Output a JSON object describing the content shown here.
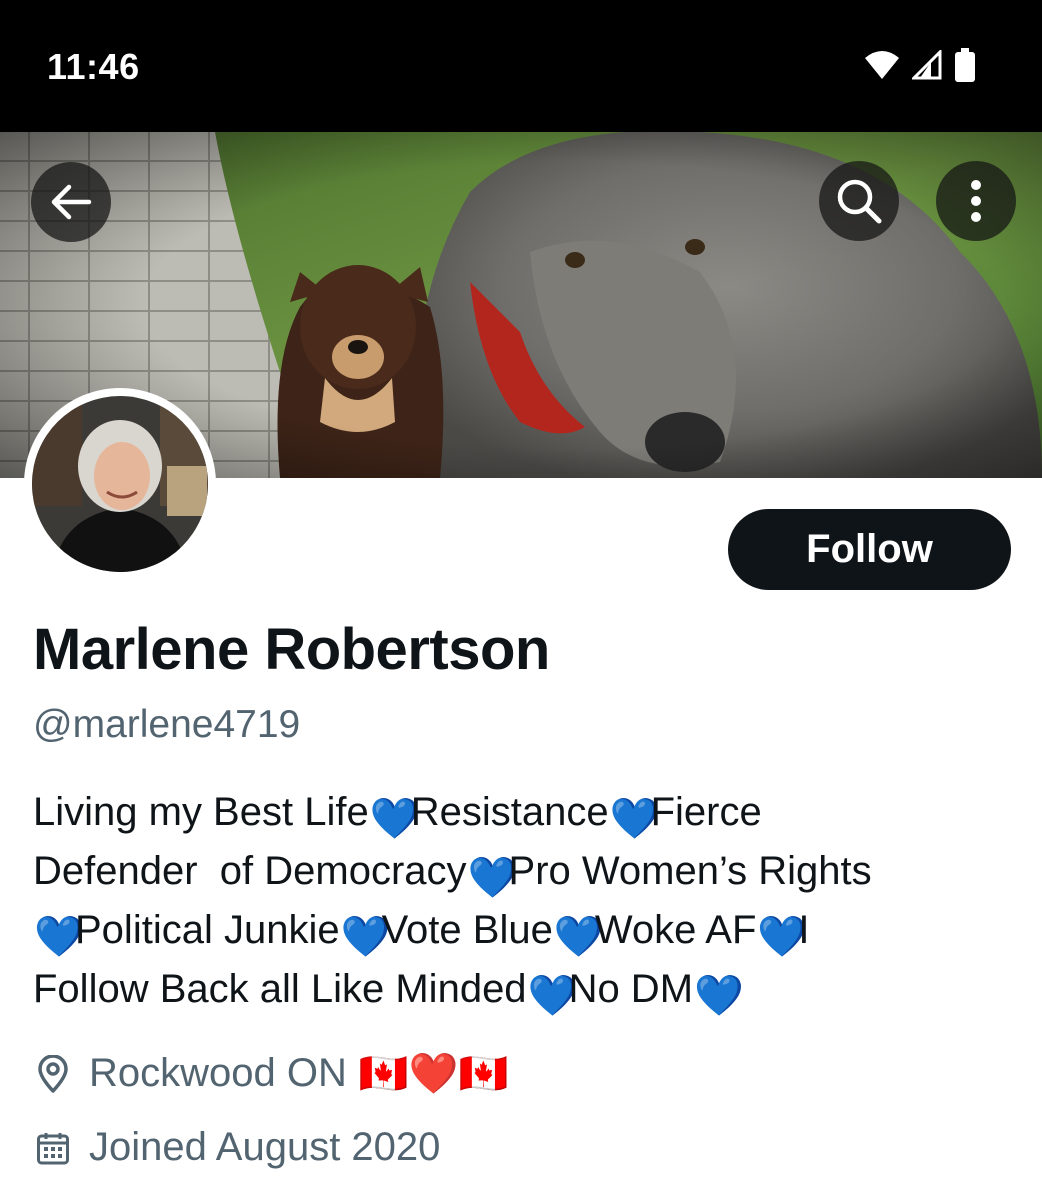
{
  "status_bar": {
    "time": "11:46",
    "icons": [
      "wifi-icon",
      "cell-signal-icon",
      "battery-icon"
    ]
  },
  "header": {
    "buttons": [
      "back-arrow-icon",
      "search-icon",
      "more-vertical-icon"
    ]
  },
  "profile": {
    "display_name": "Marlene Robertson",
    "handle": "@marlene4719",
    "follow_label": "Follow",
    "bio": [
      [
        "Living my Best Life",
        "💙",
        "Resistance",
        "💙",
        "Fierce"
      ],
      [
        "Defender  of Democracy",
        "💙",
        "Pro Women’s Rights"
      ],
      [
        "💙",
        "Political Junkie",
        "💙",
        "Vote Blue",
        "💙",
        "Woke AF",
        "💙",
        "I"
      ],
      [
        "Follow Back all Like Minded",
        "💙",
        "No DM",
        "💙"
      ]
    ],
    "location": "Rockwood ON",
    "location_emoji": "🇨🇦❤️🇨🇦",
    "joined": "Joined August 2020"
  },
  "colors": {
    "text": "#0f1419",
    "secondary": "#536471",
    "follow_bg": "#0f1419",
    "heart_blue": "#2f7fd6",
    "heart_red": "#dd2e44"
  }
}
